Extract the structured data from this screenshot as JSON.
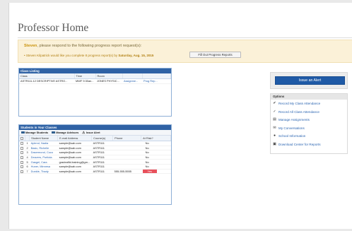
{
  "page": {
    "title": "Professor Home"
  },
  "alert": {
    "name": "Steven",
    "message": ", please respond to the following progress report request(s):",
    "item_prefix": "• Steven Kilpatrick would like you complete 8 progress report(s) by ",
    "item_date": "Saturday, Aug. 15, 2015",
    "button_label": "Fill Out Progress Reports"
  },
  "class_listing": {
    "title": "Class Listing",
    "columns": [
      "Class",
      "Time",
      "Room",
      "",
      ""
    ],
    "rows": [
      {
        "class": "ASTR111-12 DESCRIPTIVE ASTRO...",
        "time": "MWF 9:30an...",
        "room": "JONES PHYSIC...",
        "assign": "Assignme...",
        "prog": "Prog Rep..."
      }
    ]
  },
  "students": {
    "title": "Students in Your Classes",
    "toolbar": {
      "manage_students": "Manage Students",
      "manage_advisors": "Manage Advisors",
      "issue_alert": "Issue Alert"
    },
    "columns": [
      "",
      "",
      "Student Name",
      "E-mail Address",
      "Course(s)",
      "Phone",
      "At Risk?"
    ],
    "rows": [
      {
        "n": "1",
        "name": "Aplend, Nadia",
        "email": "sample@sab.com",
        "course": "ASTR111",
        "phone": "",
        "risk": "No"
      },
      {
        "n": "2",
        "name": "Basic, Richelle",
        "email": "sample@sab.com",
        "course": "ASTR111",
        "phone": "",
        "risk": "No"
      },
      {
        "n": "3",
        "name": "Dasermond, Coco",
        "email": "sample@sab.com",
        "course": "ASTR111",
        "phone": "",
        "risk": "No"
      },
      {
        "n": "4",
        "name": "Deavers, Portiola",
        "email": "sample@sab.com",
        "course": "ASTR111",
        "phone": "",
        "risk": "No"
      },
      {
        "n": "5",
        "name": "Gasgel, Cara",
        "email": "gradeafild.training@gm...",
        "course": "ASTR111",
        "phone": "",
        "risk": "No"
      },
      {
        "n": "6",
        "name": "Huner, Minnesa",
        "email": "sample@sab.com",
        "course": "ASTR111",
        "phone": "",
        "risk": "No"
      },
      {
        "n": "7",
        "name": "Dunkle, Thady",
        "email": "sample@sab.com",
        "course": "ASTR111",
        "phone": "555-555-5555",
        "risk": "Yes"
      }
    ]
  },
  "sidebar": {
    "issue_alert": "Issue an Alert",
    "options_title": "Options",
    "options": [
      {
        "icon": "check-icon",
        "label": "Record My Class Attendance"
      },
      {
        "icon": "checks-icon",
        "label": "Record All Class Attendance"
      },
      {
        "icon": "list-icon",
        "label": "Manage Assignments"
      },
      {
        "icon": "envelope-icon",
        "label": "My Conversations"
      },
      {
        "icon": "info-icon",
        "label": "School Information"
      },
      {
        "icon": "download-icon",
        "label": "Download Center for Reports"
      }
    ]
  },
  "colors": {
    "header_blue": "#2f62a5",
    "alert_bg": "#fbf1d8",
    "risk_red": "#e8505b",
    "link": "#2a64b1"
  }
}
